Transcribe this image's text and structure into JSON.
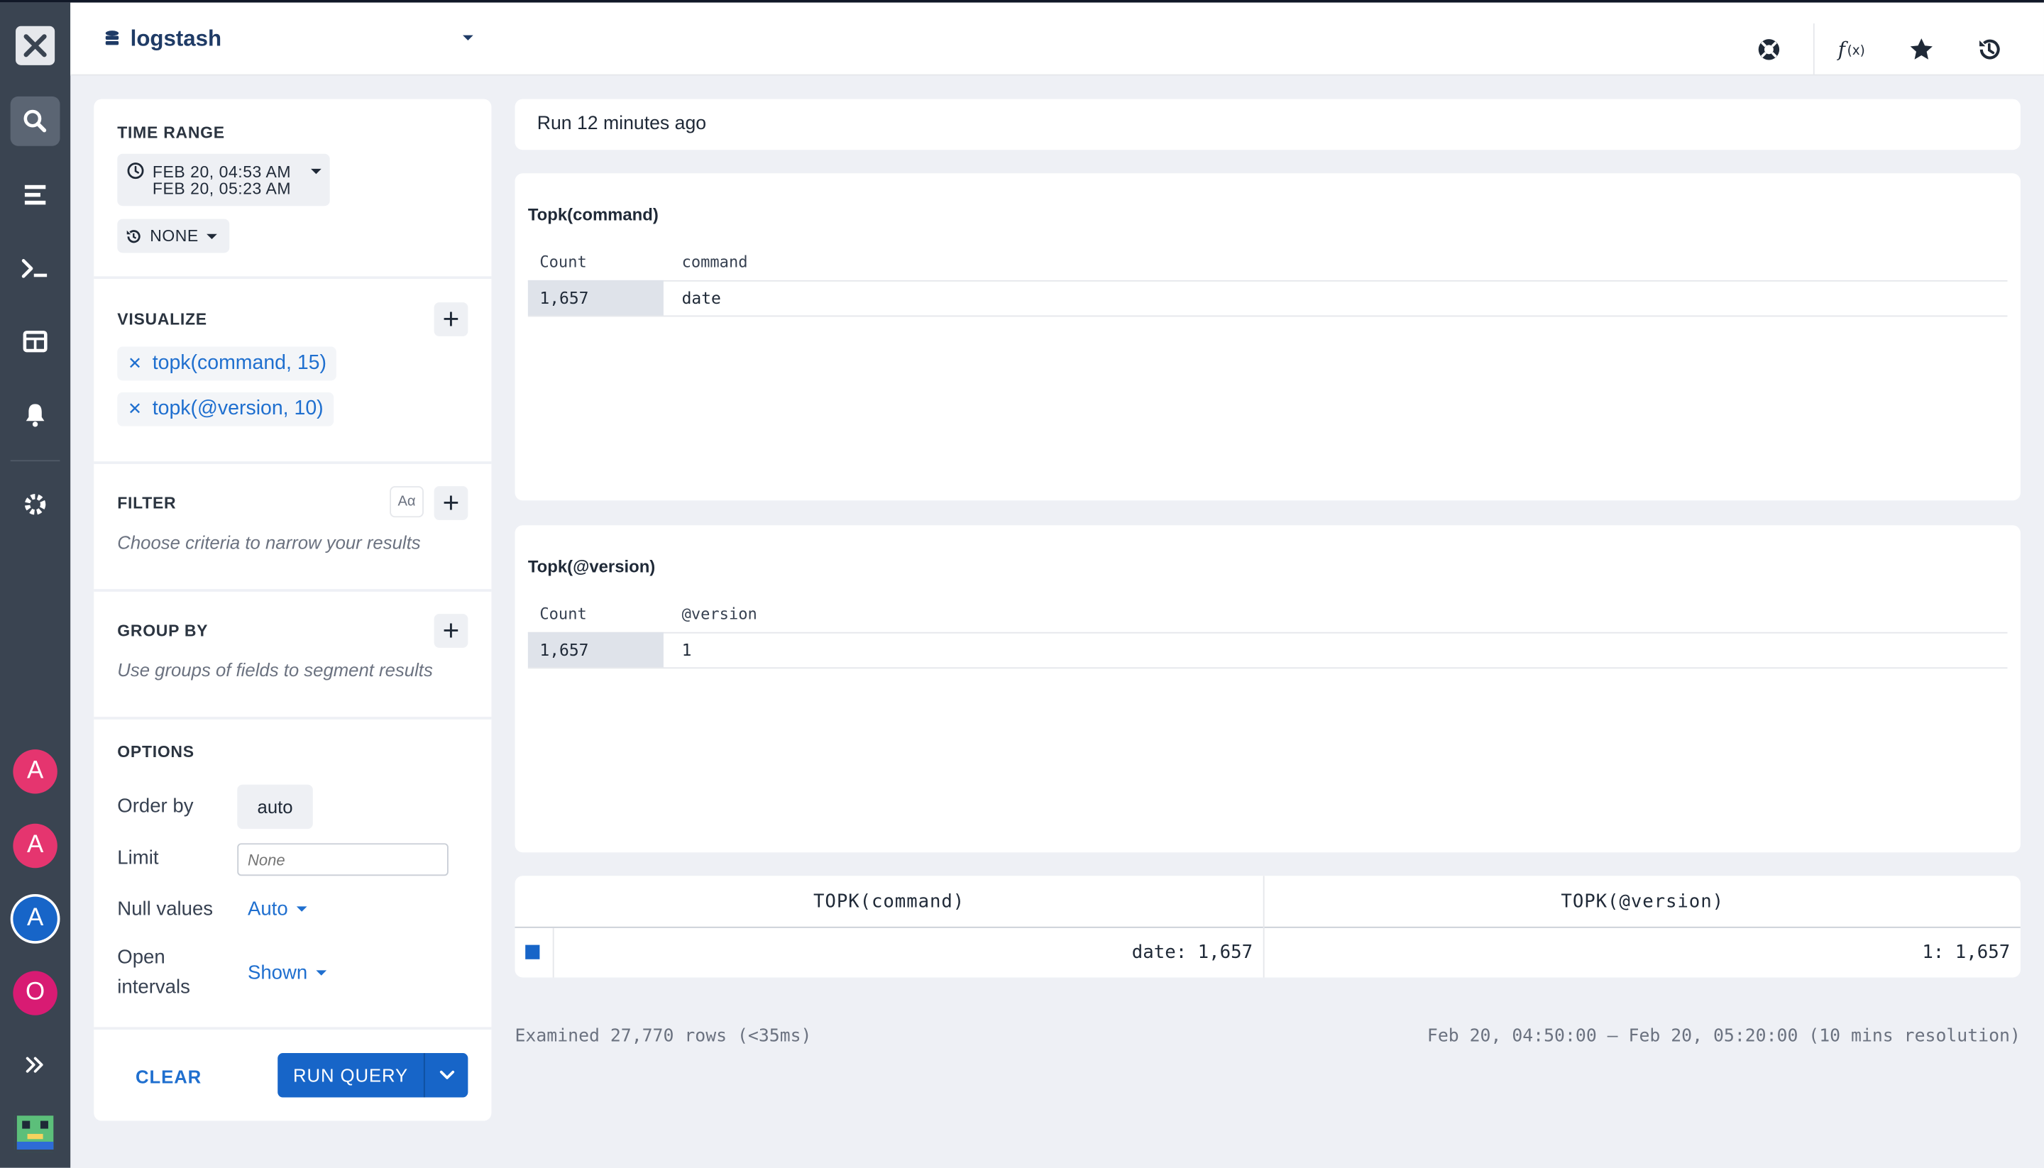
{
  "header": {
    "datasource": "logstash"
  },
  "sidebar": {
    "avatars": [
      {
        "letter": "A",
        "color": "#e5356f"
      },
      {
        "letter": "A",
        "color": "#e5356f"
      },
      {
        "letter": "A",
        "color": "#1765c8"
      },
      {
        "letter": "O",
        "color": "#d81b73"
      }
    ]
  },
  "query": {
    "time_range": {
      "title": "TIME RANGE",
      "start": "FEB 20, 04:53 AM",
      "end": "FEB 20, 05:23 AM",
      "compare": "NONE"
    },
    "visualize": {
      "title": "VISUALIZE",
      "items": [
        "topk(command, 15)",
        "topk(@version, 10)"
      ]
    },
    "filter": {
      "title": "FILTER",
      "case_label": "Aα",
      "hint": "Choose criteria to narrow your results"
    },
    "group_by": {
      "title": "GROUP BY",
      "hint": "Use groups of fields to segment results"
    },
    "options": {
      "title": "OPTIONS",
      "order_by_label": "Order by",
      "order_by_value": "auto",
      "limit_label": "Limit",
      "limit_placeholder": "None",
      "null_values_label": "Null values",
      "null_values_value": "Auto",
      "open_intervals_label_1": "Open",
      "open_intervals_label_2": "intervals",
      "open_intervals_value": "Shown"
    },
    "actions": {
      "clear": "CLEAR",
      "run": "RUN QUERY"
    }
  },
  "results": {
    "run_status": "Run 12 minutes ago",
    "cards": [
      {
        "title": "Topk(command)",
        "col_count": "Count",
        "col_field": "command",
        "rows": [
          {
            "count": "1,657",
            "value": "date"
          }
        ]
      },
      {
        "title": "Topk(@version)",
        "col_count": "Count",
        "col_field": "@version",
        "rows": [
          {
            "count": "1,657",
            "value": "1"
          }
        ]
      }
    ],
    "totals": {
      "headers": [
        "TOPK(command)",
        "TOPK(@version)"
      ],
      "values": [
        "date: 1,657",
        "1: 1,657"
      ]
    },
    "footer_left": "Examined 27,770 rows (<35ms)",
    "footer_right": "Feb 20, 04:50:00 — Feb 20, 05:20:00 (10 mins resolution)"
  },
  "colors": {
    "accent": "#1765c8",
    "sidebar_bg": "#3a4451"
  }
}
